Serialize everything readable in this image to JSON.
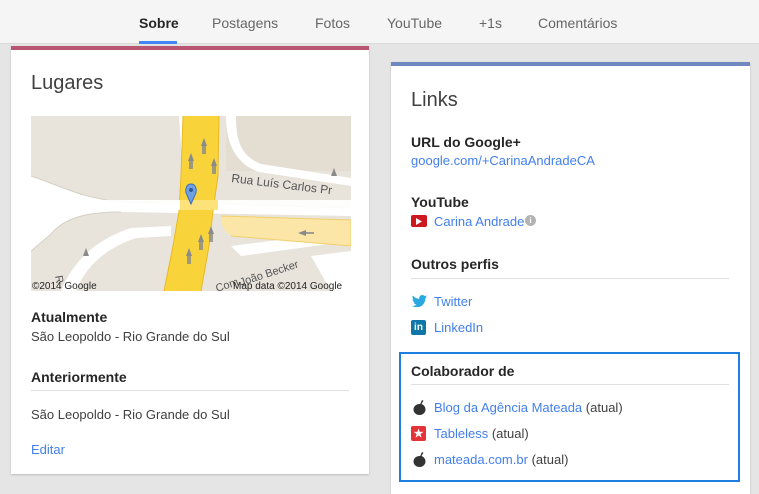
{
  "nav": {
    "tabs": [
      {
        "label": "Sobre"
      },
      {
        "label": "Postagens"
      },
      {
        "label": "Fotos"
      },
      {
        "label": "YouTube"
      },
      {
        "label": "+1s"
      },
      {
        "label": "Comentários"
      }
    ],
    "active": "Sobre",
    "accent": "#4285f4"
  },
  "places": {
    "title": "Lugares",
    "map": {
      "street_1": "Rua Luís Carlos Pr",
      "street_2": "João Becker",
      "street_3": "Com",
      "street_4": "R",
      "copyright_left": "©2014 Google",
      "copyright_right": "Map data ©2014 Google"
    },
    "current_label": "Atualmente",
    "current_value": "São Leopoldo - Rio Grande do Sul",
    "previous_label": "Anteriormente",
    "previous_value": "São Leopoldo - Rio Grande do Sul",
    "edit_label": "Editar",
    "accent": "#b85572"
  },
  "links": {
    "title": "Links",
    "accent": "#6f88c0",
    "google_plus": {
      "label": "URL do Google+",
      "url": "google.com/+CarinaAndradeCA"
    },
    "youtube": {
      "label": "YouTube",
      "channel": "Carina Andrade",
      "icon": "youtube-icon",
      "info_icon": "info-icon"
    },
    "other_profiles": {
      "label": "Outros perfis",
      "items": [
        {
          "name": "Twitter",
          "icon": "twitter-icon"
        },
        {
          "name": "LinkedIn",
          "icon": "linkedin-icon"
        }
      ]
    },
    "contributor": {
      "label": "Colaborador de",
      "items": [
        {
          "name": "Blog da Agência Mateada",
          "suffix": "(atual)",
          "icon": "mate-gourd-icon"
        },
        {
          "name": "Tableless",
          "suffix": "(atual)",
          "icon": "tableless-icon"
        },
        {
          "name": "mateada.com.br",
          "suffix": "(atual)",
          "icon": "mate-gourd-icon"
        }
      ],
      "highlight_color": "#1e7fe3"
    }
  }
}
